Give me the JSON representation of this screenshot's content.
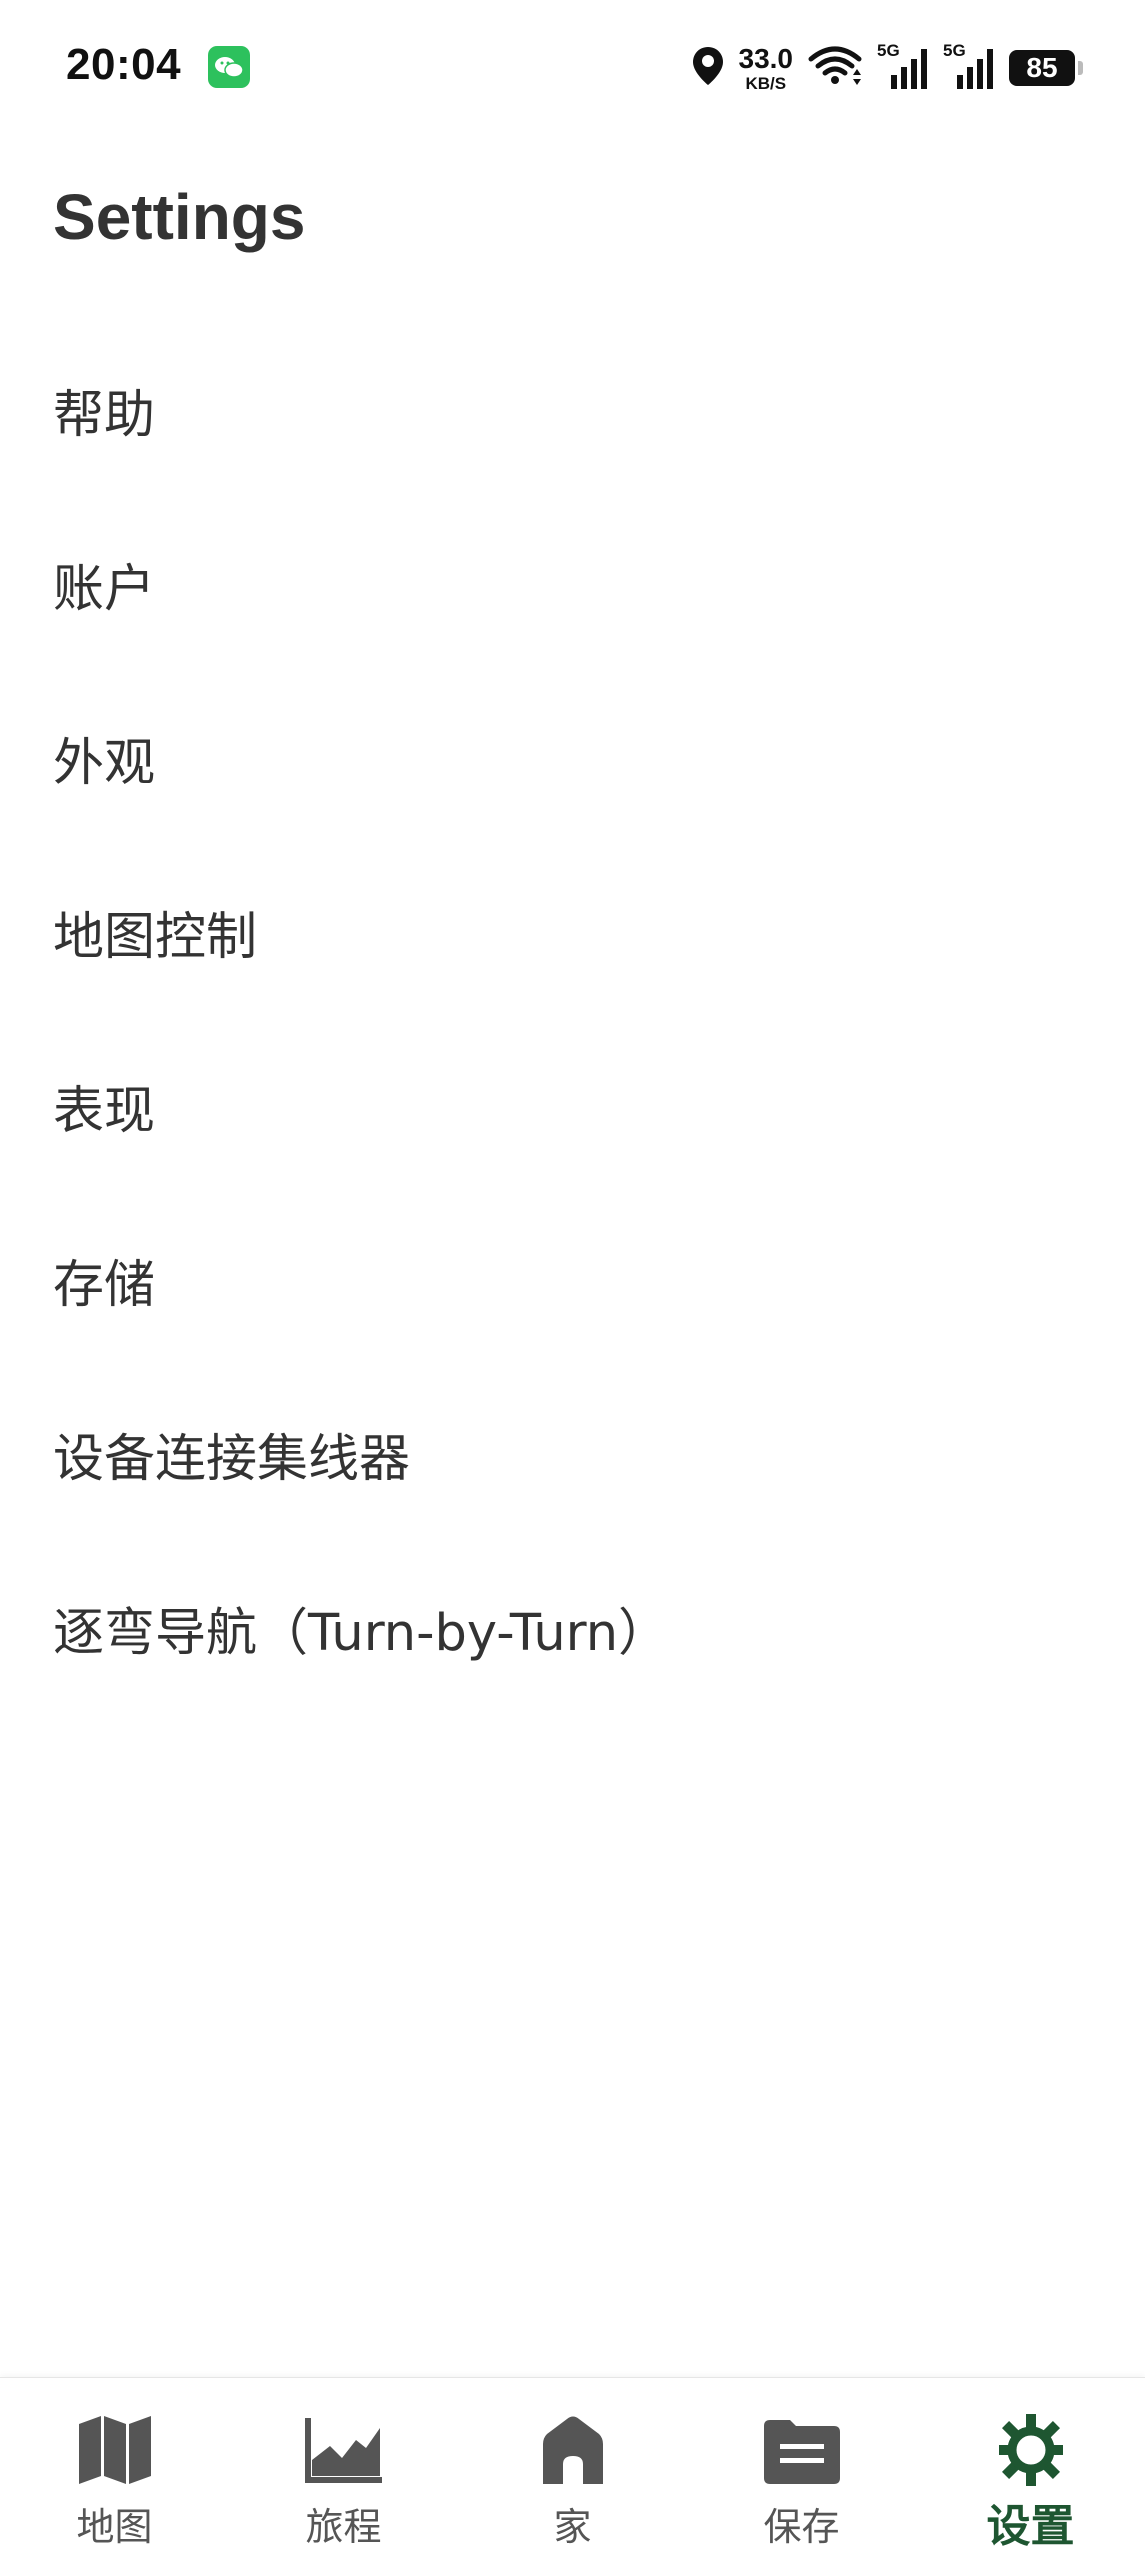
{
  "status_bar": {
    "time": "20:04",
    "net_speed": "33.0",
    "net_speed_unit": "KB/S",
    "sim1_label": "5G",
    "sim2_label": "5G",
    "battery": "85"
  },
  "header": {
    "title": "Settings"
  },
  "settings": {
    "items": [
      {
        "label": "帮助"
      },
      {
        "label": "账户"
      },
      {
        "label": "外观"
      },
      {
        "label": "地图控制"
      },
      {
        "label": "表现"
      },
      {
        "label": "存储"
      },
      {
        "label": "设备连接集线器"
      },
      {
        "label": "逐弯导航（Turn-by-Turn）"
      }
    ]
  },
  "bottom_nav": {
    "items": [
      {
        "label": "地图",
        "icon": "map-icon"
      },
      {
        "label": "旅程",
        "icon": "trip-chart-icon"
      },
      {
        "label": "家",
        "icon": "home-icon"
      },
      {
        "label": "保存",
        "icon": "folder-icon"
      },
      {
        "label": "设置",
        "icon": "gear-icon",
        "active": true
      }
    ]
  },
  "colors": {
    "text": "#333333",
    "nav_icon": "#555555",
    "accent_active": "#1e5631",
    "wechat_green": "#2dc15d"
  }
}
